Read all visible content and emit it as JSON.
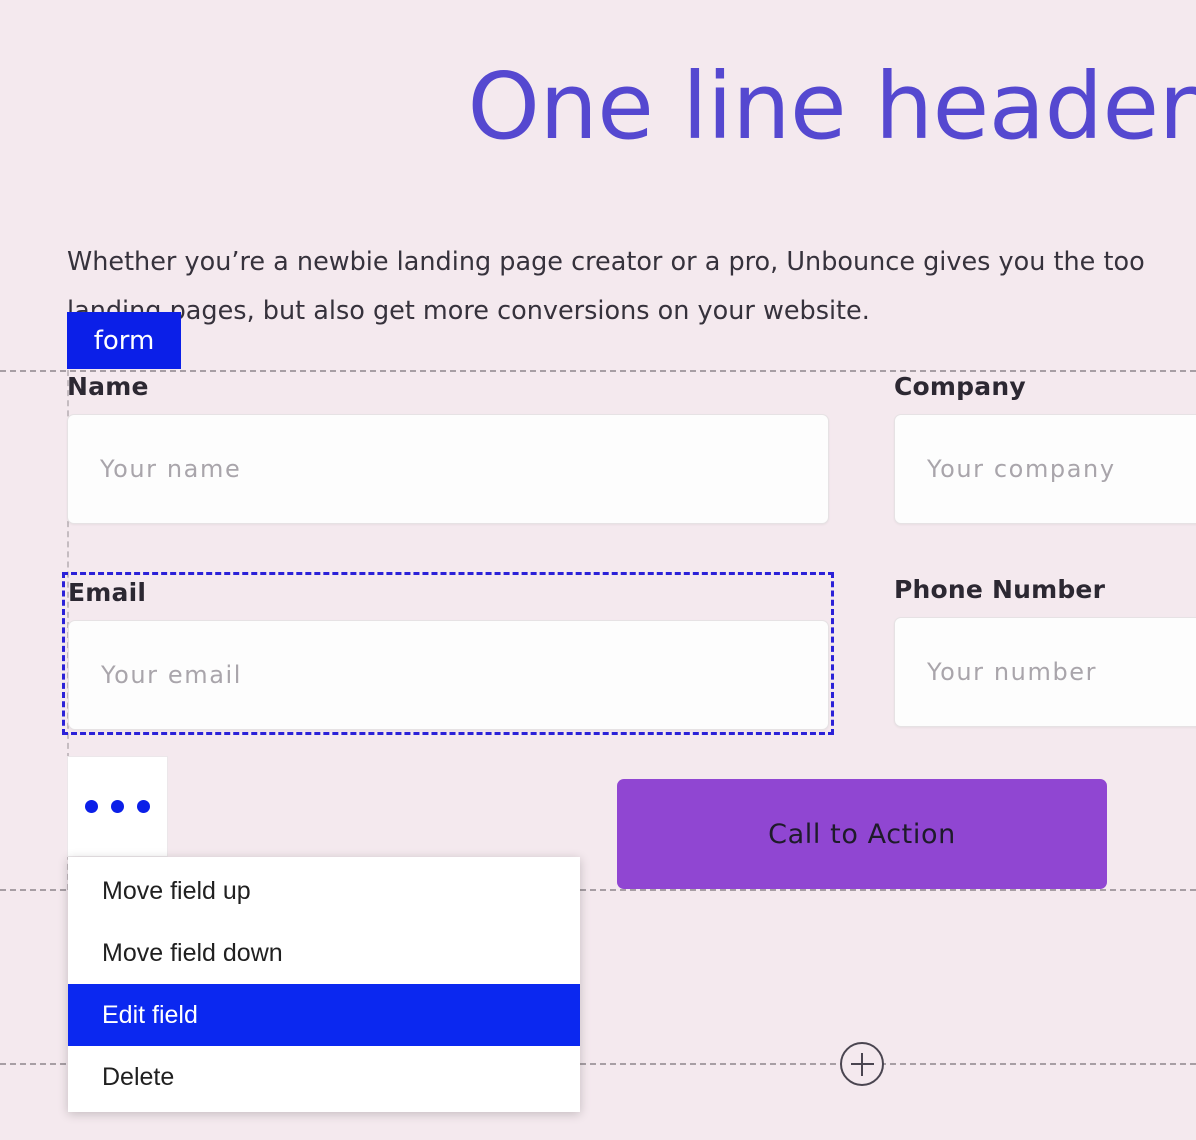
{
  "page": {
    "header": "One line header",
    "subtext": "Whether you’re a newbie landing page creator or a pro, Unbounce gives you the too\nlanding pages, but also get more conversions on your website.",
    "background_color": "#f4e9ee",
    "header_color": "#5548d0"
  },
  "form": {
    "badge_label": "form",
    "badge_color": "#0b1fe8",
    "selection_color": "#2b21d8",
    "fields": [
      {
        "id": "name",
        "label": "Name",
        "placeholder": "Your name",
        "value": "",
        "selected": false
      },
      {
        "id": "company",
        "label": "Company",
        "placeholder": "Your company",
        "value": "",
        "selected": false
      },
      {
        "id": "email",
        "label": "Email",
        "placeholder": "Your email",
        "value": "",
        "selected": true
      },
      {
        "id": "phone",
        "label": "Phone Number",
        "placeholder": "Your number",
        "value": "",
        "selected": false
      }
    ]
  },
  "field_options": {
    "icon": "ellipsis-horizontal-icon",
    "dot_color": "#0b1fe8"
  },
  "context_menu": {
    "items": [
      {
        "label": "Move field up",
        "highlighted": false
      },
      {
        "label": "Move field down",
        "highlighted": false
      },
      {
        "label": "Edit field",
        "highlighted": true
      },
      {
        "label": "Delete",
        "highlighted": false
      }
    ],
    "highlight_color": "#0b28f0"
  },
  "cta": {
    "label": "Call to Action",
    "background_color": "#9046d2",
    "text_color": "#1e1b2a"
  },
  "add_row": {
    "icon": "plus-circle-icon",
    "label": "+"
  }
}
